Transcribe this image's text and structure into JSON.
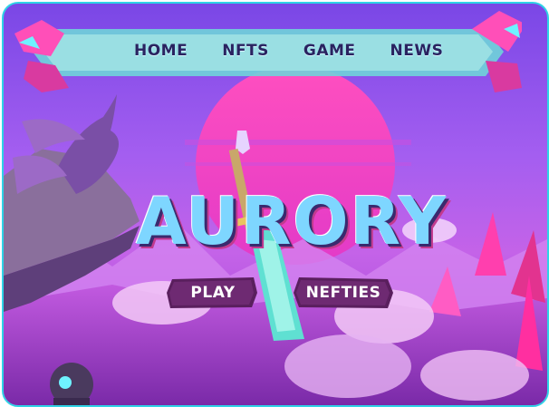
{
  "nav": {
    "links": [
      "HOME",
      "NFTS",
      "GAME",
      "NEWS"
    ]
  },
  "hero": {
    "title": "AURORY"
  },
  "buttons": {
    "play_label": "PLAY",
    "nefties_label": "NEFTIES"
  },
  "colors": {
    "border": "#2fd3e6",
    "sky_top": "#7a47e6",
    "sun": "#f04cc8",
    "button_bg": "#5a1f5e",
    "title_fill": "#7ed6ff"
  },
  "icons": [
    "sword-icon",
    "crystal-icon",
    "dragon-icon",
    "flower-icon"
  ]
}
